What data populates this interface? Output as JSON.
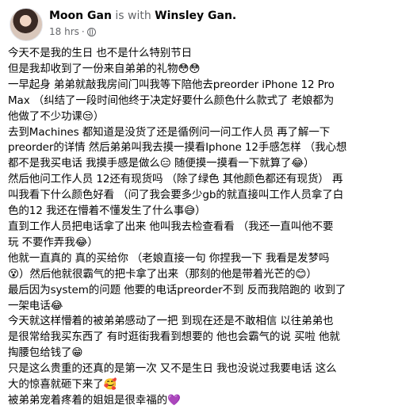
{
  "post": {
    "author": "Moon Gan",
    "with_text": "is with",
    "tagged": "Winsley Gan.",
    "timestamp": "18 hrs",
    "separator": "·",
    "privacy_icon": "globe-icon",
    "lines": [
      "今天不是我的生日 也不是什么特别节日",
      "但是我却收到了一份来自弟弟的礼物😳😳",
      "一早起身 弟弟就敲我房间门叫我等下陪他去preorder iPhone 12 Pro",
      "Max （纠结了一段时间他终于决定好要什么颜色什么款式了 老娘都为",
      "他做了不少功课😒）",
      "去到Machines 都知道是没货了还是循例问一问工作人员 再了解一下",
      "preorder的详情 然后弟弟叫我去摸一摸看Iphone 12手感怎样 （我心想",
      "都不是我买电话 我摸手感是做么😑 随便摸一摸看一下就算了😂）",
      "然后他问工作人员 12还有现货吗 （除了绿色 其他颜色都还有现货） 再",
      "叫我看下什么颜色好看 （问了我会要多少gb的就直接叫工作人员拿了白",
      "色的12 我还在懵着不懂发生了什么事😅）",
      "直到工作人员把电话拿了出来 他叫我去检查看看 （我还一直叫他不要",
      "玩 不要作弄我😂）",
      "他就一直真的 真的买给你 （老娘直接一句 你捏我一下 我看是发梦吗",
      "😵）然后他就很霸气的把卡拿了出来（那刻的他是带着光芒的😊）",
      "最后因为system的问题 他要的电话preorder不到 反而我陪跑的 收到了",
      "一架电话😂",
      "今天就这样懵着的被弟弟感动了一把 到现在还是不敢相信 以往弟弟也",
      "是很常给我买东西了 有时逛街我看到想要的 他也会霸气的说 买啦 他就",
      "掏腰包给钱了😁",
      "只是这么贵重的还真的是第一次 又不是生日 我也没说过我要电话 这么",
      "大的惊喜就砸下来了🥰",
      "被弟弟宠着疼着的姐姐是很幸福的💜"
    ]
  }
}
